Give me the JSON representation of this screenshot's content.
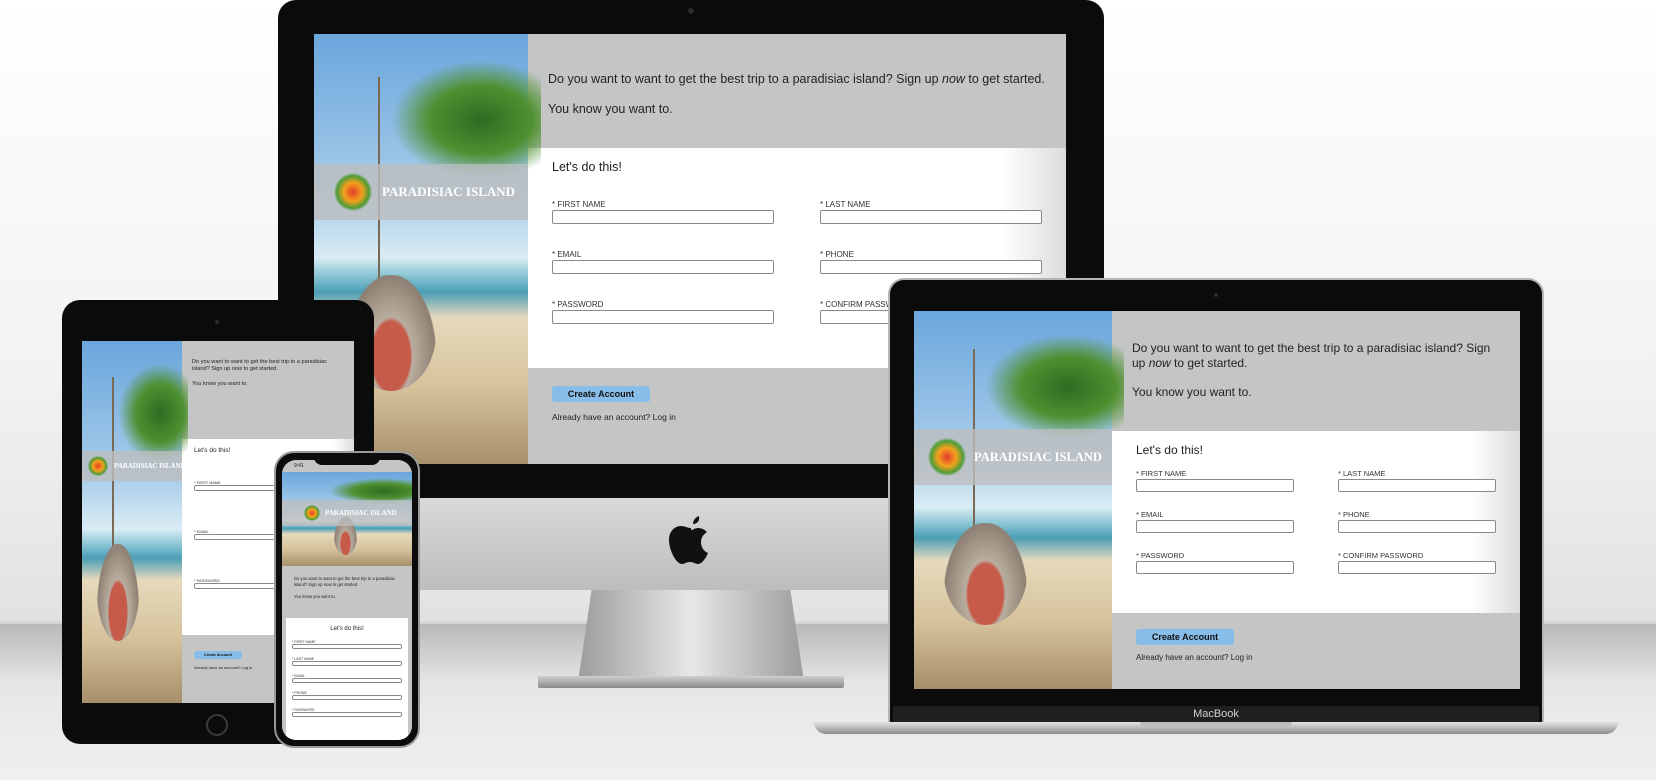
{
  "brand": {
    "name": "PARADISIAC ISLAND"
  },
  "intro": {
    "text_before": "Do you want to want to get the best trip to a paradisiac island? Sign up ",
    "text_emphasis": "now",
    "text_after": " to get started.",
    "line2": "You know you want to."
  },
  "form": {
    "heading": "Let's do this!",
    "fields": {
      "first_name": "* FIRST NAME",
      "last_name": "* LAST NAME",
      "email": "* EMAIL",
      "phone": "* PHONE",
      "password": "* PASSWORD",
      "confirm_password": "* CONFIRM PASSWORD"
    },
    "submit_label": "Create Account",
    "login_prompt": "Already have an account? Log in"
  },
  "devices": {
    "macbook_label": "MacBook",
    "phone_time": "9:41"
  },
  "colors": {
    "panel_gray": "#c4c6c5",
    "button_blue": "#87bde8",
    "bezel": "#0b0b0b"
  }
}
